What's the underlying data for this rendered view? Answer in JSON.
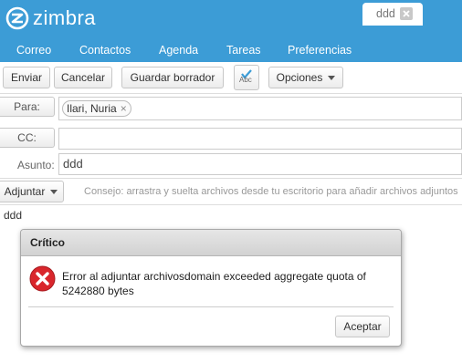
{
  "app": {
    "logo_text": "zimbra"
  },
  "tabs": [
    {
      "label": "Correo"
    },
    {
      "label": "Contactos"
    },
    {
      "label": "Agenda"
    },
    {
      "label": "Tareas"
    },
    {
      "label": "Preferencias"
    },
    {
      "label": "ddd"
    }
  ],
  "toolbar": {
    "send": "Enviar",
    "cancel": "Cancelar",
    "save_draft": "Guardar borrador",
    "spell_sub": "Abc",
    "options": "Opciones"
  },
  "compose": {
    "to_label": "Para:",
    "to_chip": "Ilari, Nuria",
    "chip_remove": "×",
    "cc_label": "CC:",
    "subject_label": "Asunto:",
    "subject_value": "ddd",
    "attach_label": "Adjuntar",
    "attach_hint": "Consejo: arrastra y suelta archivos desde tu escritorio para añadir archivos adjuntos",
    "body": "ddd"
  },
  "dialog": {
    "title": "Crítico",
    "message": "Error al adjuntar archivosdomain exceeded aggregate quota of 5242880 bytes",
    "ok": "Aceptar"
  },
  "colors": {
    "header": "#3c9cd6",
    "error_icon": "#d9262c"
  }
}
